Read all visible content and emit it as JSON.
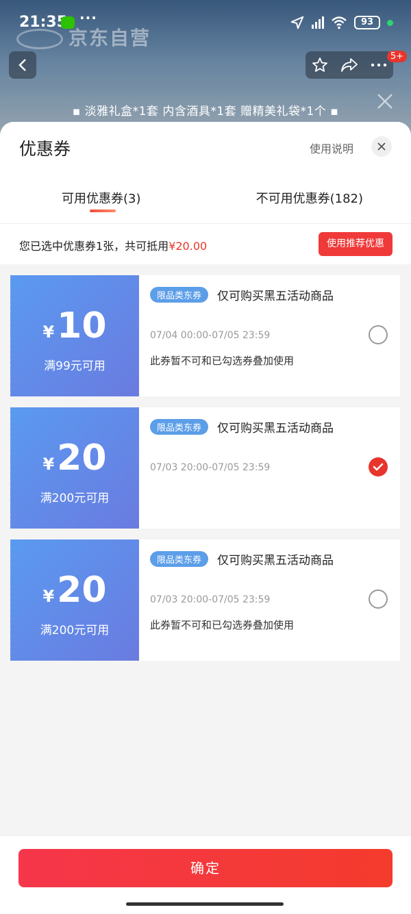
{
  "status_bar": {
    "time": "21:35",
    "dots": "···",
    "battery": "93"
  },
  "background": {
    "watermark": "京东自营",
    "badge": "5+",
    "promo": "▪ 淡雅礼盒*1套 内含酒具*1套 赠精美礼袋*1个 ▪"
  },
  "sheet": {
    "title": "优惠券",
    "usage_link": "使用说明",
    "tabs": [
      {
        "label": "可用优惠券(3)",
        "active": true
      },
      {
        "label": "不可用优惠券(182)",
        "active": false
      }
    ],
    "summary": {
      "text": "您已选中优惠券1张，共可抵用",
      "amount": "¥20.00"
    },
    "recommend_button": "使用推荐优惠"
  },
  "coupons": [
    {
      "yen": "¥",
      "amount": "10",
      "threshold": "满99元可用",
      "tag": "限品类东券",
      "desc": "仅可购买黑五活动商品",
      "validity": "07/04 00:00-07/05 23:59",
      "note": "此券暂不可和已勾选券叠加使用",
      "selected": false
    },
    {
      "yen": "¥",
      "amount": "20",
      "threshold": "满200元可用",
      "tag": "限品类东券",
      "desc": "仅可购买黑五活动商品",
      "validity": "07/03 20:00-07/05 23:59",
      "note": "",
      "selected": true
    },
    {
      "yen": "¥",
      "amount": "20",
      "threshold": "满200元可用",
      "tag": "限品类东券",
      "desc": "仅可购买黑五活动商品",
      "validity": "07/03 20:00-07/05 23:59",
      "note": "此券暂不可和已勾选券叠加使用",
      "selected": false
    }
  ],
  "footer": {
    "confirm": "确定"
  },
  "colors": {
    "accent_red": "#e8352c",
    "coupon_blue": "#5a9af0",
    "tag_blue": "#5c9ee8"
  }
}
